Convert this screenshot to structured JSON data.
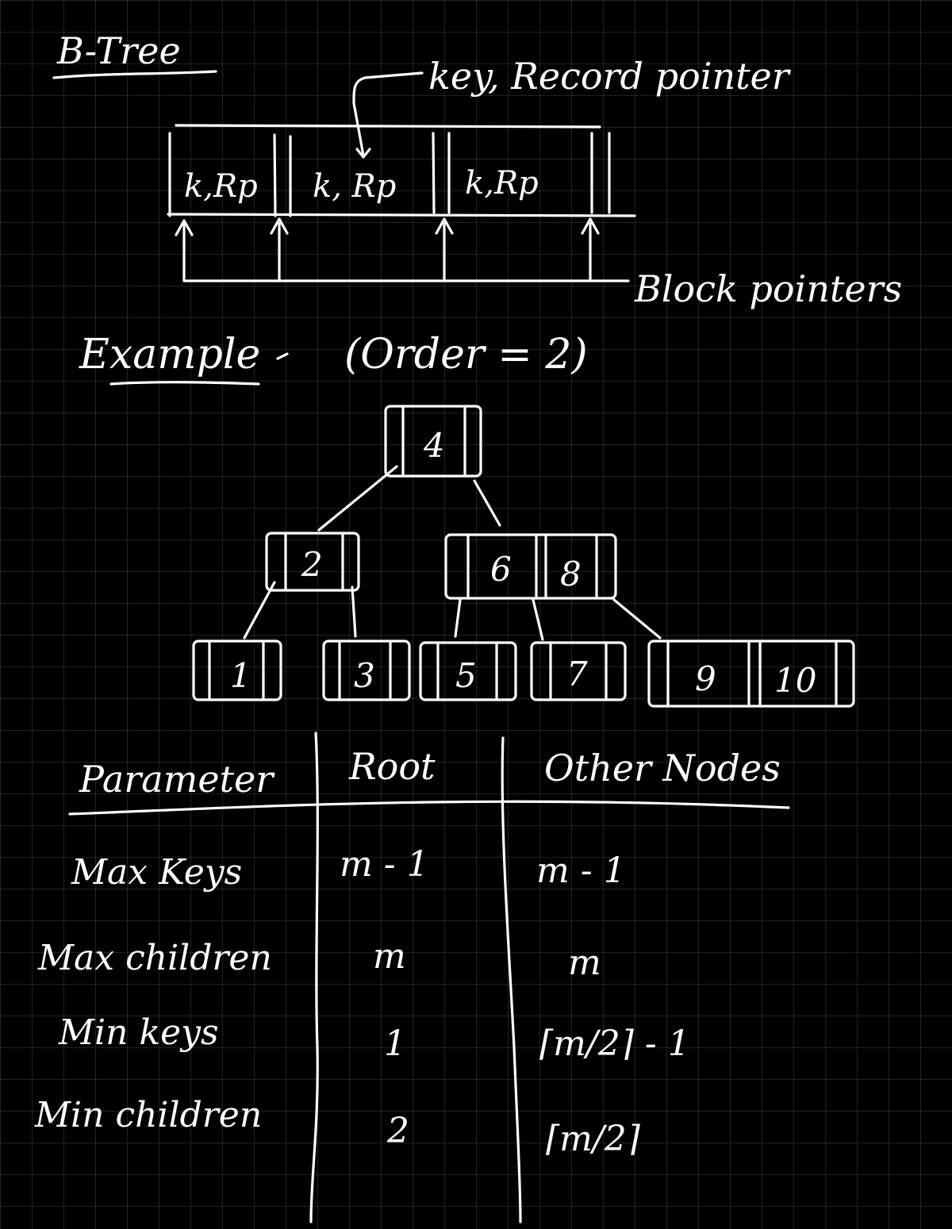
{
  "title": "B-Tree",
  "node_structure": {
    "entries": [
      "k,Rp",
      "k, Rp",
      "k,Rp"
    ],
    "callout_top": "key, Record pointer",
    "callout_bottom": "Block pointers"
  },
  "example": {
    "heading": "Example",
    "order": "(Order = 2)",
    "tree": {
      "root": [
        "4"
      ],
      "level1": [
        [
          "2"
        ],
        [
          "6",
          "8"
        ]
      ],
      "leaves": [
        [
          "1"
        ],
        [
          "3"
        ],
        [
          "5"
        ],
        [
          "7"
        ],
        [
          "9",
          "10"
        ]
      ]
    }
  },
  "table": {
    "headers": [
      "Parameter",
      "Root",
      "Other Nodes"
    ],
    "rows": [
      {
        "parameter": "Max Keys",
        "root": "m - 1",
        "other": "m - 1"
      },
      {
        "parameter": "Max children",
        "root": "m",
        "other": "m"
      },
      {
        "parameter": "Min keys",
        "root": "1",
        "other": "⌈m/2⌉ - 1"
      },
      {
        "parameter": "Min children",
        "root": "2",
        "other": "⌈m/2⌉"
      }
    ]
  },
  "colors": {
    "background": "#000000",
    "ink": "#ffffff",
    "grid": "#3a3a3a"
  }
}
